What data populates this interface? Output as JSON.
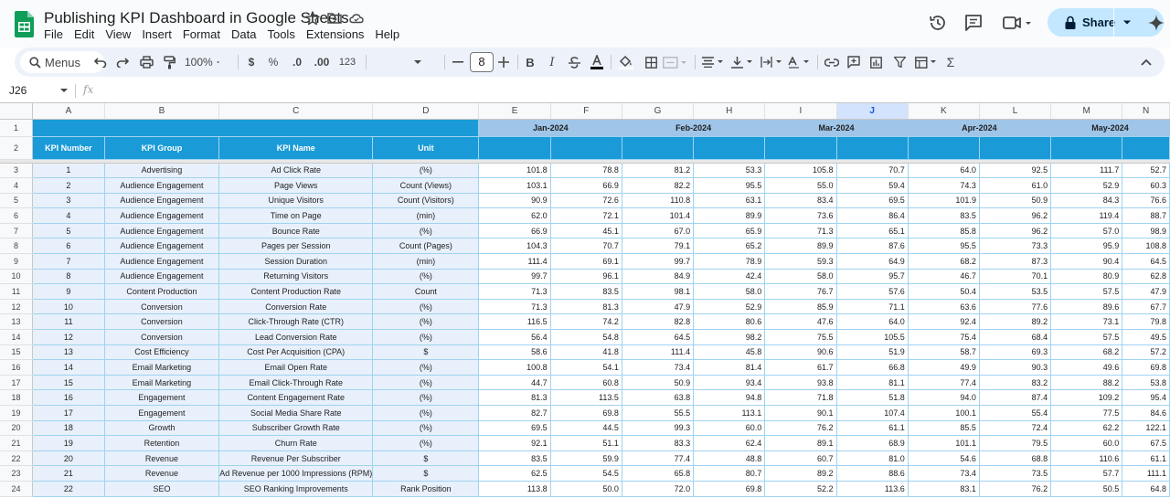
{
  "app": {
    "doc_title": "Publishing KPI Dashboard in Google Sheets",
    "menu": [
      "File",
      "Edit",
      "View",
      "Insert",
      "Format",
      "Data",
      "Tools",
      "Extensions",
      "Help"
    ],
    "share_label": "Share"
  },
  "toolbar": {
    "search_label": "Menus",
    "zoom": "100%",
    "currency": "$",
    "percent": "%",
    "dec_decrease": ".0",
    "dec_increase": ".00",
    "number_format": "123",
    "font_size": "8",
    "bold": "B",
    "italic": "I",
    "functions": "Σ"
  },
  "formula_bar": {
    "cell_ref": "J26",
    "fx": "fx"
  },
  "sheet": {
    "columns": [
      "A",
      "B",
      "C",
      "D",
      "E",
      "F",
      "G",
      "H",
      "I",
      "J",
      "K",
      "L",
      "M",
      "N"
    ],
    "selected_column": "J",
    "months": [
      "Jan-2024",
      "Feb-2024",
      "Mar-2024",
      "Apr-2024",
      "May-2024"
    ],
    "headers": [
      "KPI Number",
      "KPI Group",
      "KPI Name",
      "Unit"
    ],
    "row_numbers": [
      "1",
      "2",
      "3",
      "4",
      "5",
      "6",
      "7",
      "8",
      "9",
      "10",
      "11",
      "12",
      "13",
      "14",
      "15",
      "16",
      "17",
      "18",
      "19",
      "20",
      "21",
      "22",
      "23",
      "24"
    ],
    "rows": [
      {
        "num": "1",
        "group": "Advertising",
        "name": "Ad Click Rate",
        "unit": "(%)",
        "values": [
          "101.8",
          "78.8",
          "81.2",
          "53.3",
          "105.8",
          "70.7",
          "64.0",
          "92.5",
          "111.7",
          "52.7"
        ]
      },
      {
        "num": "2",
        "group": "Audience Engagement",
        "name": "Page Views",
        "unit": "Count (Views)",
        "values": [
          "103.1",
          "66.9",
          "82.2",
          "95.5",
          "55.0",
          "59.4",
          "74.3",
          "61.0",
          "52.9",
          "60.3"
        ]
      },
      {
        "num": "3",
        "group": "Audience Engagement",
        "name": "Unique Visitors",
        "unit": "Count (Visitors)",
        "values": [
          "90.9",
          "72.6",
          "110.8",
          "63.1",
          "83.4",
          "69.5",
          "101.9",
          "50.9",
          "84.3",
          "76.6"
        ]
      },
      {
        "num": "4",
        "group": "Audience Engagement",
        "name": "Time on Page",
        "unit": "(min)",
        "values": [
          "62.0",
          "72.1",
          "101.4",
          "89.9",
          "73.6",
          "86.4",
          "83.5",
          "96.2",
          "119.4",
          "88.7"
        ]
      },
      {
        "num": "5",
        "group": "Audience Engagement",
        "name": "Bounce Rate",
        "unit": "(%)",
        "values": [
          "66.9",
          "45.1",
          "67.0",
          "65.9",
          "71.3",
          "65.1",
          "85.8",
          "96.2",
          "57.0",
          "98.9"
        ]
      },
      {
        "num": "6",
        "group": "Audience Engagement",
        "name": "Pages per Session",
        "unit": "Count (Pages)",
        "values": [
          "104.3",
          "70.7",
          "79.1",
          "65.2",
          "89.9",
          "87.6",
          "95.5",
          "73.3",
          "95.9",
          "108.8"
        ]
      },
      {
        "num": "7",
        "group": "Audience Engagement",
        "name": "Session Duration",
        "unit": "(min)",
        "values": [
          "111.4",
          "69.1",
          "99.7",
          "78.9",
          "59.3",
          "64.9",
          "68.2",
          "87.3",
          "90.4",
          "64.5"
        ]
      },
      {
        "num": "8",
        "group": "Audience Engagement",
        "name": "Returning Visitors",
        "unit": "(%)",
        "values": [
          "99.7",
          "96.1",
          "84.9",
          "42.4",
          "58.0",
          "95.7",
          "46.7",
          "70.1",
          "80.9",
          "62.8"
        ]
      },
      {
        "num": "9",
        "group": "Content Production",
        "name": "Content Production Rate",
        "unit": "Count",
        "values": [
          "71.3",
          "83.5",
          "98.1",
          "58.0",
          "76.7",
          "57.6",
          "50.4",
          "53.5",
          "57.5",
          "47.9"
        ]
      },
      {
        "num": "10",
        "group": "Conversion",
        "name": "Conversion Rate",
        "unit": "(%)",
        "values": [
          "71.3",
          "81.3",
          "47.9",
          "52.9",
          "85.9",
          "71.1",
          "63.6",
          "77.6",
          "89.6",
          "67.7"
        ]
      },
      {
        "num": "11",
        "group": "Conversion",
        "name": "Click-Through Rate (CTR)",
        "unit": "(%)",
        "values": [
          "116.5",
          "74.2",
          "82.8",
          "80.6",
          "47.6",
          "64.0",
          "92.4",
          "89.2",
          "73.1",
          "79.8"
        ]
      },
      {
        "num": "12",
        "group": "Conversion",
        "name": "Lead Conversion Rate",
        "unit": "(%)",
        "values": [
          "56.4",
          "54.8",
          "64.5",
          "98.2",
          "75.5",
          "105.5",
          "75.4",
          "68.4",
          "57.5",
          "49.5"
        ]
      },
      {
        "num": "13",
        "group": "Cost Efficiency",
        "name": "Cost Per Acquisition (CPA)",
        "unit": "$",
        "values": [
          "58.6",
          "41.8",
          "111.4",
          "45.8",
          "90.6",
          "51.9",
          "58.7",
          "69.3",
          "68.2",
          "57.2"
        ]
      },
      {
        "num": "14",
        "group": "Email Marketing",
        "name": "Email Open Rate",
        "unit": "(%)",
        "values": [
          "100.8",
          "54.1",
          "73.4",
          "81.4",
          "61.7",
          "66.8",
          "49.9",
          "90.3",
          "49.6",
          "69.8"
        ]
      },
      {
        "num": "15",
        "group": "Email Marketing",
        "name": "Email Click-Through Rate",
        "unit": "(%)",
        "values": [
          "44.7",
          "60.8",
          "50.9",
          "93.4",
          "93.8",
          "81.1",
          "77.4",
          "83.2",
          "88.2",
          "53.8"
        ]
      },
      {
        "num": "16",
        "group": "Engagement",
        "name": "Content Engagement Rate",
        "unit": "(%)",
        "values": [
          "81.3",
          "113.5",
          "63.8",
          "94.8",
          "71.8",
          "51.8",
          "94.0",
          "87.4",
          "109.2",
          "95.4"
        ]
      },
      {
        "num": "17",
        "group": "Engagement",
        "name": "Social Media Share Rate",
        "unit": "(%)",
        "values": [
          "82.7",
          "69.8",
          "55.5",
          "113.1",
          "90.1",
          "107.4",
          "100.1",
          "55.4",
          "77.5",
          "84.6"
        ]
      },
      {
        "num": "18",
        "group": "Growth",
        "name": "Subscriber Growth Rate",
        "unit": "(%)",
        "values": [
          "69.5",
          "44.5",
          "99.3",
          "60.0",
          "76.2",
          "61.1",
          "85.5",
          "72.4",
          "62.2",
          "122.1"
        ]
      },
      {
        "num": "19",
        "group": "Retention",
        "name": "Churn Rate",
        "unit": "(%)",
        "values": [
          "92.1",
          "51.1",
          "83.3",
          "62.4",
          "89.1",
          "68.9",
          "101.1",
          "79.5",
          "60.0",
          "67.5"
        ]
      },
      {
        "num": "20",
        "group": "Revenue",
        "name": "Revenue Per Subscriber",
        "unit": "$",
        "values": [
          "83.5",
          "59.9",
          "77.4",
          "48.8",
          "60.7",
          "81.0",
          "54.6",
          "68.8",
          "110.6",
          "61.1"
        ]
      },
      {
        "num": "21",
        "group": "Revenue",
        "name": "Ad Revenue per 1000 Impressions (RPM)",
        "unit": "$",
        "values": [
          "62.5",
          "54.5",
          "65.8",
          "80.7",
          "89.2",
          "88.6",
          "73.4",
          "73.5",
          "57.7",
          "111.1"
        ]
      },
      {
        "num": "22",
        "group": "SEO",
        "name": "SEO Ranking Improvements",
        "unit": "Rank Position",
        "values": [
          "113.8",
          "50.0",
          "72.0",
          "69.8",
          "52.2",
          "113.6",
          "83.1",
          "76.2",
          "50.5",
          "64.8"
        ]
      }
    ]
  },
  "colors": {
    "header_blue": "#1a9bd7",
    "month_band": "#9fc5e8",
    "kpi_fill": "#e8f0fb",
    "share_button": "#c2e7ff"
  }
}
